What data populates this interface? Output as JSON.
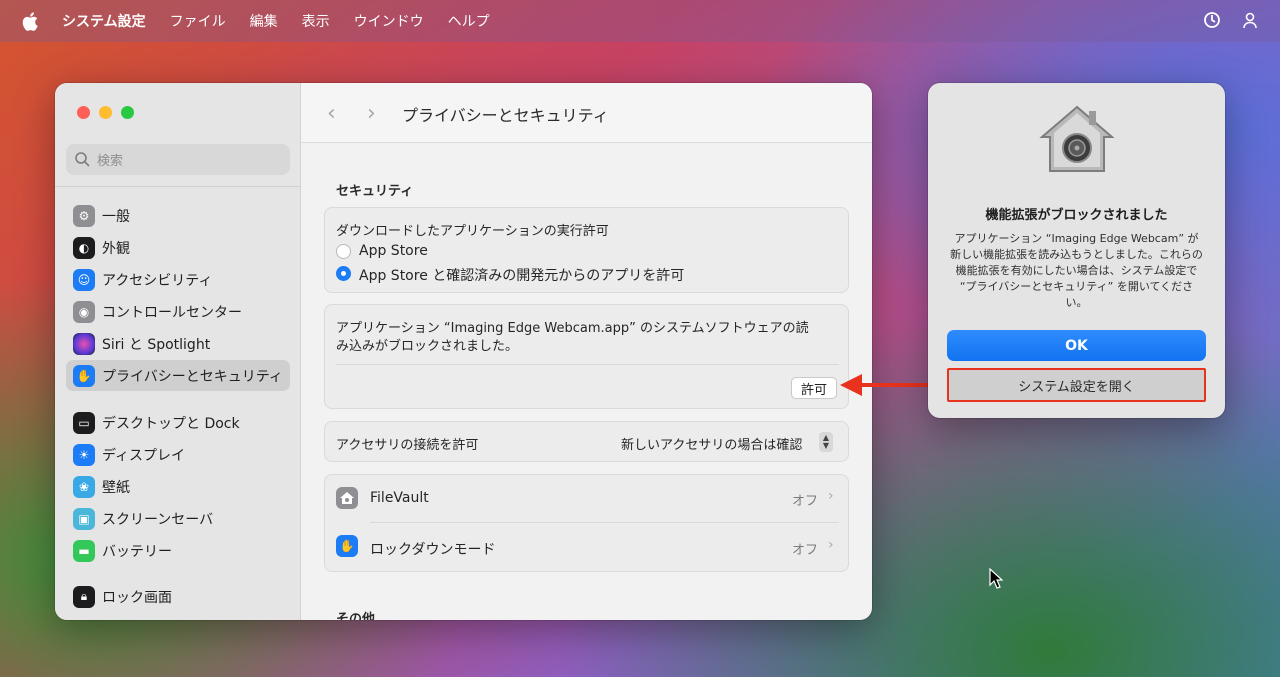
{
  "menubar": {
    "app_name": "システム設定",
    "items": [
      "ファイル",
      "編集",
      "表示",
      "ウインドウ",
      "ヘルプ"
    ]
  },
  "window": {
    "title": "プライバシーとセキュリティ",
    "search_placeholder": "検索"
  },
  "sidebar": {
    "groups": [
      [
        {
          "label": "一般",
          "icon": "gear-icon",
          "color": "#8e8e93"
        },
        {
          "label": "外観",
          "icon": "appearance-icon",
          "color": "#1c1c1e"
        },
        {
          "label": "アクセシビリティ",
          "icon": "accessibility-icon",
          "color": "#1b7cf5"
        },
        {
          "label": "コントロールセンター",
          "icon": "control-center-icon",
          "color": "#8e8e93"
        },
        {
          "label": "Siri と Spotlight",
          "icon": "siri-icon",
          "color": "#5b3bd6"
        },
        {
          "label": "プライバシーとセキュリティ",
          "icon": "hand-icon",
          "color": "#1b7cf5",
          "selected": true
        }
      ],
      [
        {
          "label": "デスクトップと Dock",
          "icon": "dock-icon",
          "color": "#1c1c1e"
        },
        {
          "label": "ディスプレイ",
          "icon": "display-icon",
          "color": "#1b7cf5"
        },
        {
          "label": "壁紙",
          "icon": "wallpaper-icon",
          "color": "#39a9e6"
        },
        {
          "label": "スクリーンセーバ",
          "icon": "screensaver-icon",
          "color": "#4ab6d8"
        },
        {
          "label": "バッテリー",
          "icon": "battery-icon",
          "color": "#34c759"
        }
      ],
      [
        {
          "label": "ロック画面",
          "icon": "lock-icon",
          "color": "#1c1c1e"
        }
      ]
    ]
  },
  "content": {
    "security_title": "セキュリティ",
    "download_heading": "ダウンロードしたアプリケーションの実行許可",
    "radio_app_store": "App Store",
    "radio_app_store_dev": "App Store と確認済みの開発元からのアプリを許可",
    "blocked_message_line1": "アプリケーション “Imaging Edge Webcam.app” のシステムソフトウェアの読",
    "blocked_message_line2": "み込みがブロックされました。",
    "allow_button": "許可",
    "accessory_label": "アクセサリの接続を許可",
    "accessory_value": "新しいアクセサリの場合は確認",
    "filevault_label": "FileVault",
    "filevault_value": "オフ",
    "lockdown_label": "ロックダウンモード",
    "lockdown_value": "オフ",
    "other_title": "その他"
  },
  "alert": {
    "title": "機能拡張がブロックされました",
    "message": "アプリケーション “Imaging Edge Webcam” が新しい機能拡張を読み込もうとしました。これらの機能拡張を有効にしたい場合は、システム設定で “プライバシーとセキュリティ” を開いてください。",
    "ok_button": "OK",
    "open_settings_button": "システム設定を開く"
  },
  "colors": {
    "accent": "#1b7cf5",
    "highlight": "#e8321d"
  }
}
